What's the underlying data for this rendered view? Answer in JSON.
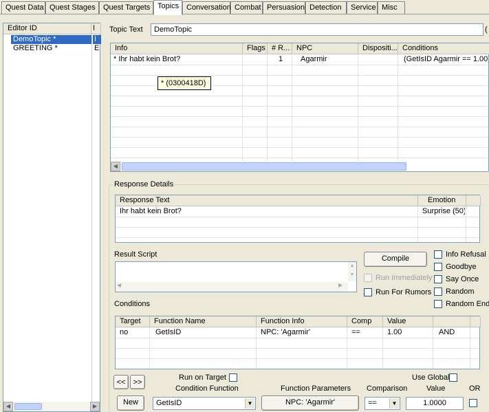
{
  "tabs": [
    "Quest Data",
    "Quest Stages",
    "Quest Targets",
    "Topics",
    "Conversation",
    "Combat",
    "Persuasion",
    "Detection",
    "Service",
    "Misc"
  ],
  "editor_list": {
    "headers": [
      "Editor ID",
      "I"
    ],
    "rows": [
      {
        "id": "DemoTopic *",
        "col2": "I"
      },
      {
        "id": "GREETING *",
        "col2": "E"
      }
    ]
  },
  "topic_text": {
    "label": "Topic Text",
    "value": "DemoTopic",
    "cut": "("
  },
  "info_table": {
    "headers": [
      "Info",
      "Flags",
      "# R...",
      "NPC",
      "Dispositi...",
      "Conditions"
    ],
    "rows": [
      {
        "info": "* Ihr habt kein Brot?",
        "flags": "",
        "r": "1",
        "npc": "Agarmir",
        "disp": "",
        "cond": "(GetIsID Agarmir == 1.00)"
      }
    ],
    "tooltip": "* (0300418D)"
  },
  "response": {
    "group_label": "Response Details",
    "headers": [
      "Response Text",
      "Emotion"
    ],
    "rows": [
      {
        "text": "Ihr habt kein Brot?",
        "emotion": "Surprise (50)"
      }
    ]
  },
  "script": {
    "label": "Result Script",
    "compile": "Compile",
    "run_immediately": "Run Immediately",
    "run_for_rumors": "Run For Rumors"
  },
  "flags": [
    "Info Refusal",
    "Goodbye",
    "Say Once",
    "Random",
    "Random End"
  ],
  "conditions": {
    "label": "Conditions",
    "headers": [
      "Target",
      "Function Name",
      "Function Info",
      "Comp",
      "Value",
      ""
    ],
    "rows": [
      {
        "target": "no",
        "fname": "GetIsID",
        "finfo": "NPC: 'Agarmir'",
        "comp": "==",
        "value": "1.00",
        "andor": "AND"
      }
    ]
  },
  "condition_editor": {
    "prev": "<<",
    "next": ">>",
    "run_on_target": "Run on Target",
    "use_global": "Use Global",
    "condition_function": "Condition Function",
    "function_parameters": "Function Parameters",
    "comparison": "Comparison",
    "value": "Value",
    "or": "OR",
    "new": "New",
    "function_value": "GetIsID",
    "param_value": "NPC: 'Agarmir'",
    "comp_value": "==",
    "value_value": "1.0000"
  },
  "colors": {
    "selection": "#316ac5",
    "background": "#ece9d8"
  }
}
